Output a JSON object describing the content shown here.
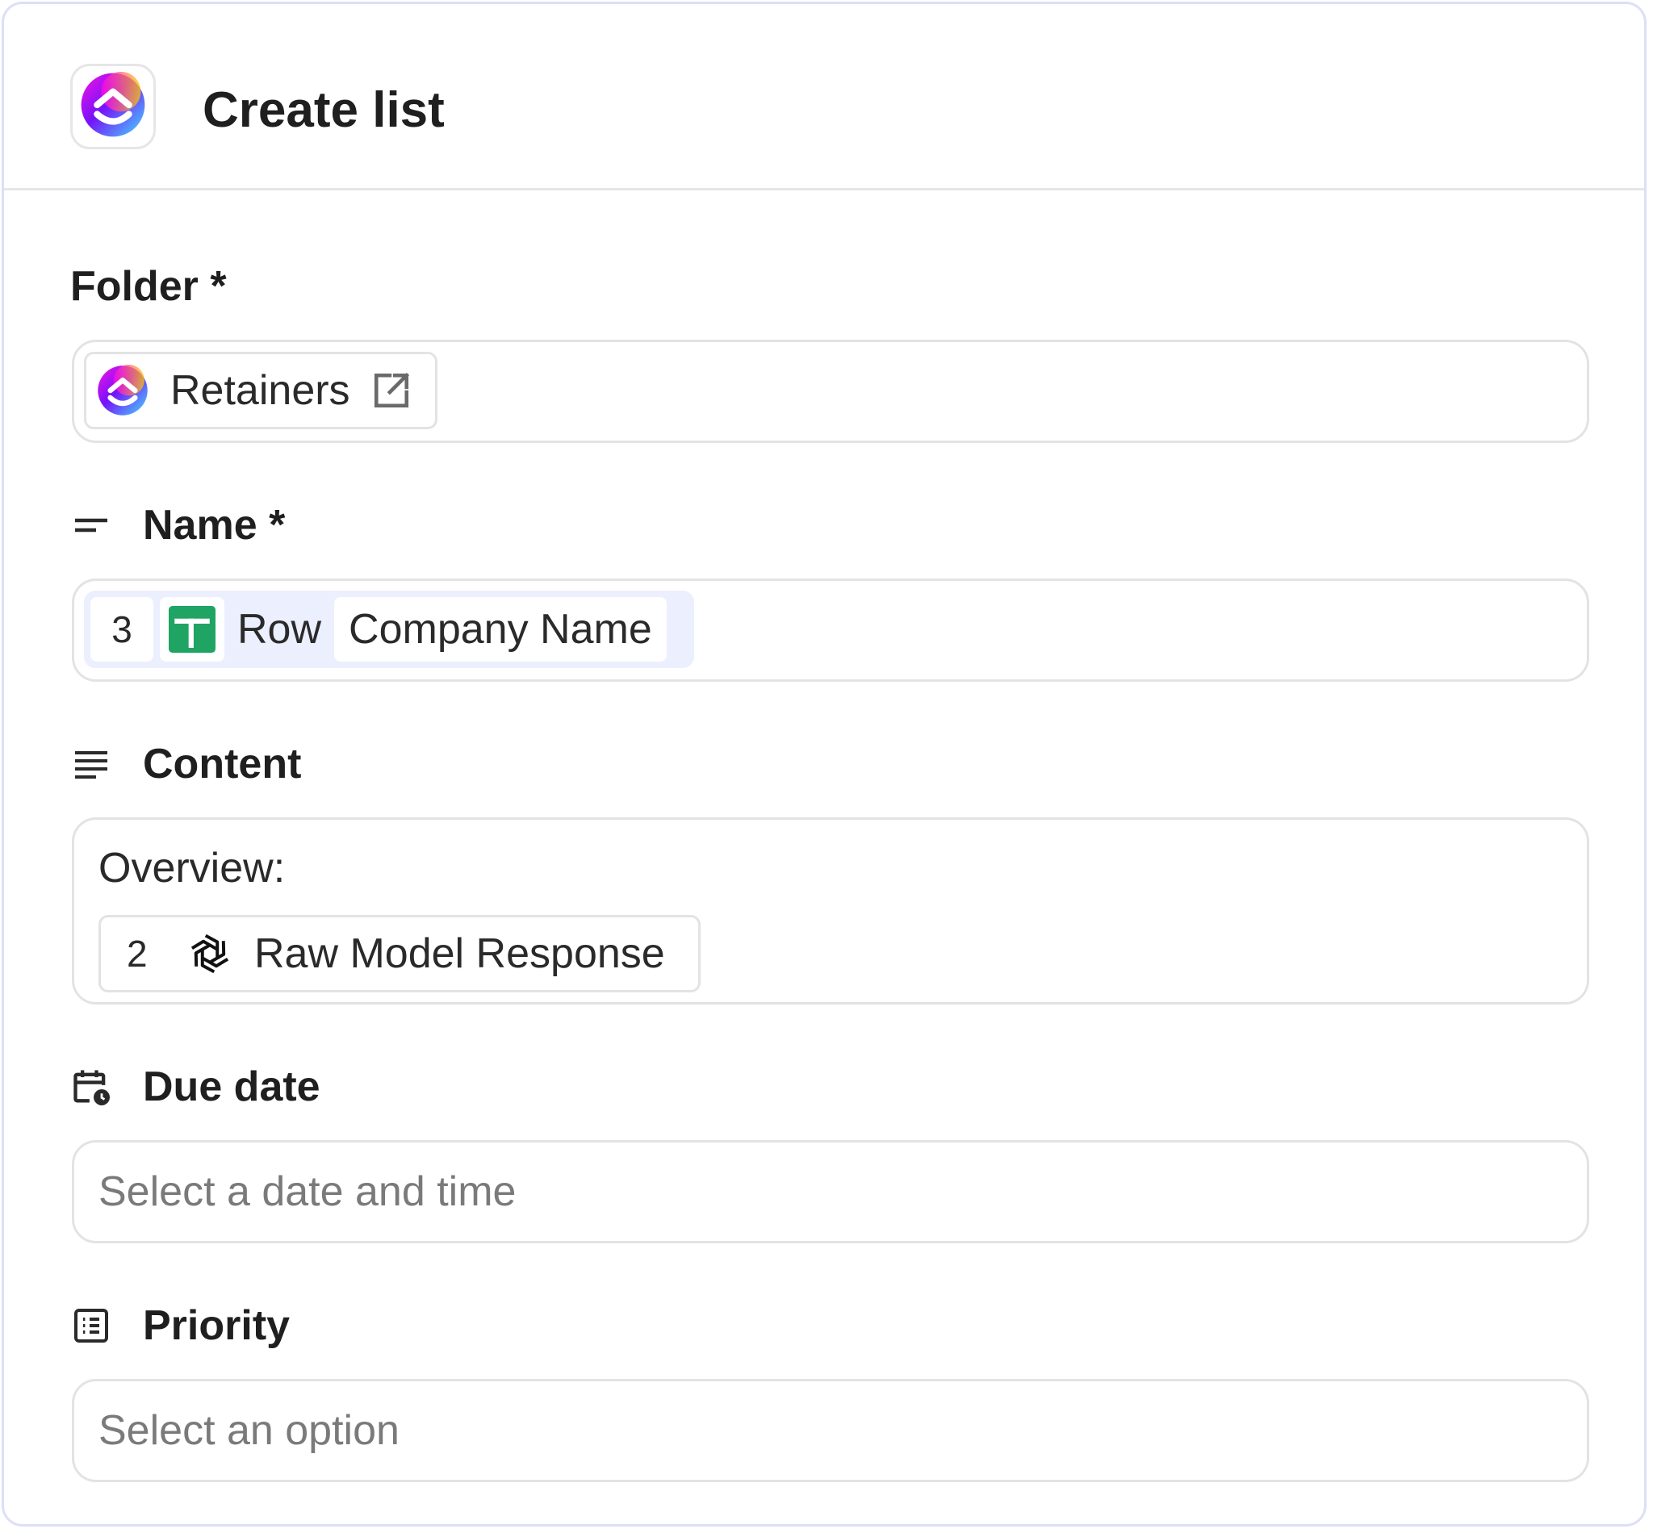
{
  "header": {
    "title": "Create list",
    "app_icon": "clickup-logo-icon"
  },
  "folder": {
    "label": "Folder *",
    "chip_text": "Retainers",
    "chip_icon": "clickup-logo-icon",
    "action_icon": "external-link-icon"
  },
  "name": {
    "label": "Name *",
    "label_icon": "short-text-icon",
    "token": {
      "step": "3",
      "source_icon": "google-sheets-icon",
      "prefix": "Row",
      "field": "Company Name"
    }
  },
  "content": {
    "label": "Content",
    "label_icon": "long-text-icon",
    "text": "Overview:",
    "token": {
      "step": "2",
      "source_icon": "openai-icon",
      "field": "Raw Model Response"
    }
  },
  "due_date": {
    "label": "Due date",
    "label_icon": "calendar-clock-icon",
    "placeholder": "Select a date and time"
  },
  "priority": {
    "label": "Priority",
    "label_icon": "list-select-icon",
    "placeholder": "Select an option"
  },
  "colors": {
    "border": "#e3e3e3",
    "panel_border": "#dcdff7",
    "token_bg": "#eceffd",
    "sheets_green": "#1fa463",
    "placeholder": "#7a7a7a"
  }
}
